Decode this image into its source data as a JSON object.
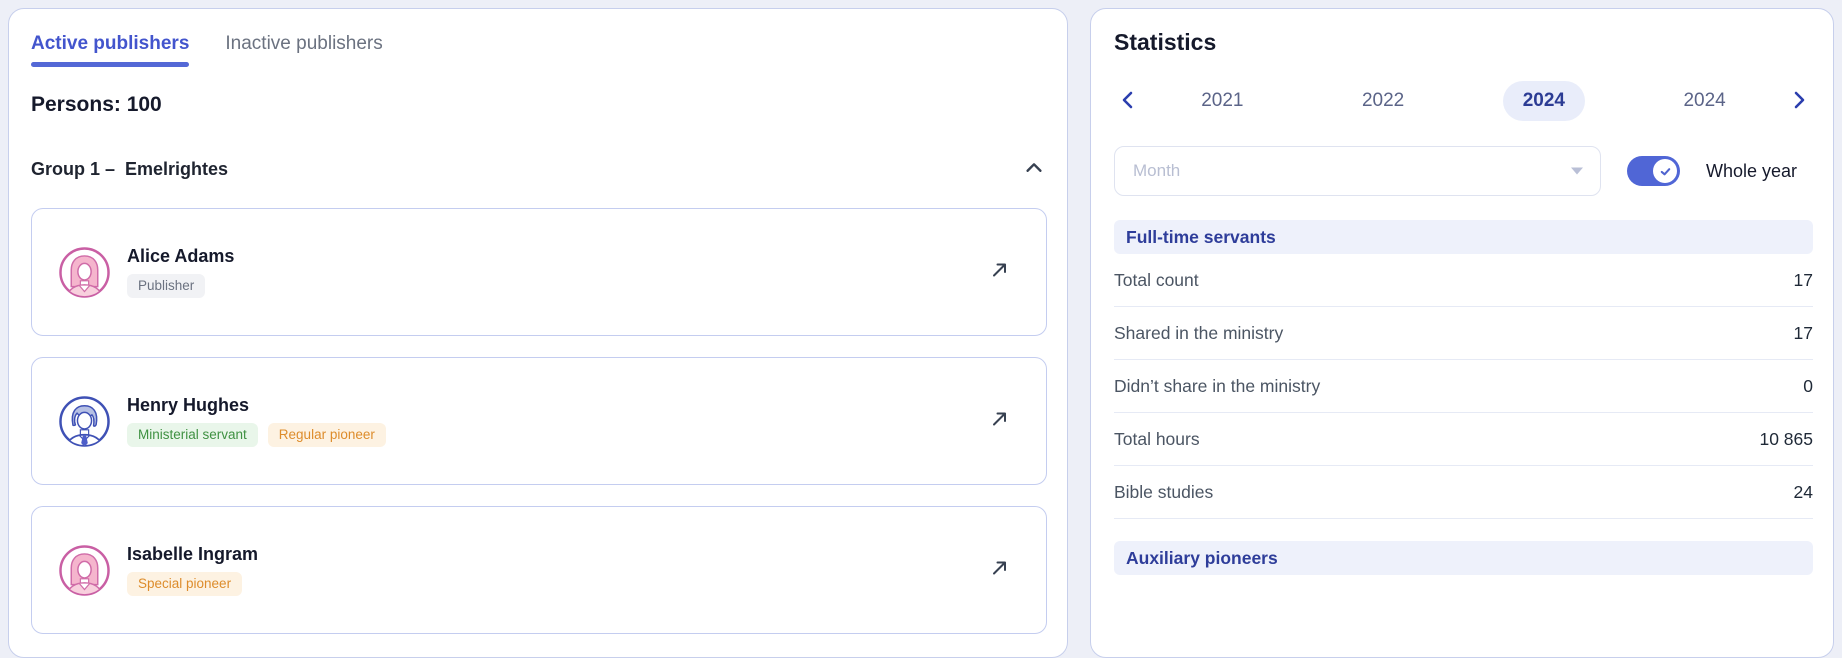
{
  "left_panel": {
    "tabs": [
      {
        "label": "Active publishers",
        "active": true
      },
      {
        "label": "Inactive publishers",
        "active": false
      }
    ],
    "persons_label": "Persons: 100",
    "group": {
      "title": "Group 1 –  Emelrightes"
    },
    "cards": [
      {
        "name": "Alice Adams",
        "avatar": "female",
        "badges": [
          {
            "label": "Publisher",
            "type": "neutral"
          }
        ]
      },
      {
        "name": "Henry Hughes",
        "avatar": "male",
        "badges": [
          {
            "label": "Ministerial servant",
            "type": "green"
          },
          {
            "label": "Regular pioneer",
            "type": "orange"
          }
        ]
      },
      {
        "name": "Isabelle Ingram",
        "avatar": "female",
        "badges": [
          {
            "label": "Special pioneer",
            "type": "orange"
          }
        ]
      }
    ]
  },
  "right_panel": {
    "title": "Statistics",
    "years": [
      {
        "label": "2021",
        "selected": false
      },
      {
        "label": "2022",
        "selected": false
      },
      {
        "label": "2024",
        "selected": true
      },
      {
        "label": "2024",
        "selected": false
      }
    ],
    "month_placeholder": "Month",
    "whole_year_label": "Whole year",
    "toggle_on": true,
    "sections": [
      {
        "title": "Full-time servants",
        "rows": [
          {
            "label": "Total count",
            "value": "17"
          },
          {
            "label": "Shared in the ministry",
            "value": "17"
          },
          {
            "label": "Didn’t share in the ministry",
            "value": "0"
          },
          {
            "label": "Total hours",
            "value": "10 865"
          },
          {
            "label": "Bible studies",
            "value": "24"
          }
        ]
      },
      {
        "title": "Auxiliary pioneers",
        "rows": []
      }
    ]
  },
  "colors": {
    "accent_indigo": "#4355cd",
    "selected_year_text": "#2c3c94",
    "selected_year_bg": "#e9edfa",
    "section_header_bg": "#eef1fb",
    "toggle_on_bg": "#5066d6",
    "badge_green_text": "#3f9142",
    "badge_orange_text": "#dd8c2b",
    "badge_neutral_text": "#6b7280",
    "avatar_female_border": "#c95fa4",
    "avatar_male_border": "#3f51b5"
  }
}
